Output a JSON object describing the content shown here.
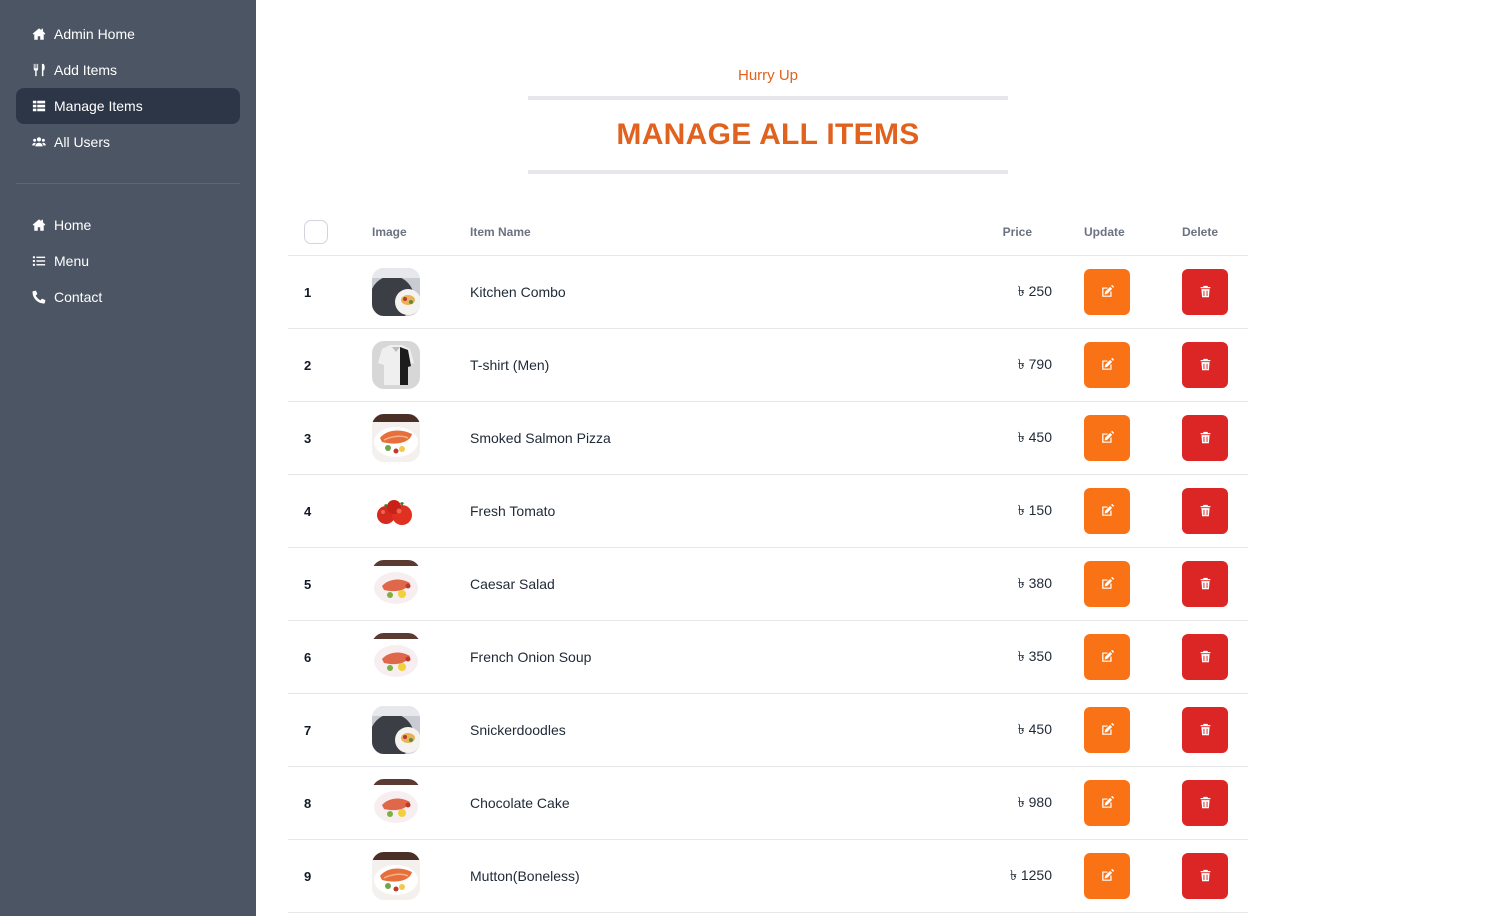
{
  "sidebar": {
    "admin_items": [
      {
        "label": "Admin Home",
        "icon": "home-icon"
      },
      {
        "label": "Add Items",
        "icon": "utensils-icon"
      },
      {
        "label": "Manage Items",
        "icon": "list-grid-icon",
        "active": true
      },
      {
        "label": "All Users",
        "icon": "users-icon"
      }
    ],
    "public_items": [
      {
        "label": "Home",
        "icon": "home-icon"
      },
      {
        "label": "Menu",
        "icon": "list-icon"
      },
      {
        "label": "Contact",
        "icon": "phone-icon"
      }
    ]
  },
  "section": {
    "subtitle": "Hurry Up",
    "title": "MANAGE ALL ITEMS"
  },
  "table": {
    "headers": {
      "image": "Image",
      "name": "Item Name",
      "price": "Price",
      "update": "Update",
      "delete": "Delete"
    },
    "currency": "৳",
    "rows": [
      {
        "num": "1",
        "name": "Kitchen Combo",
        "price": "৳ 250",
        "thumb": "plate-dark"
      },
      {
        "num": "2",
        "name": "T-shirt (Men)",
        "price": "৳ 790",
        "thumb": "shirt"
      },
      {
        "num": "3",
        "name": "Smoked Salmon Pizza",
        "price": "৳ 450",
        "thumb": "salmon"
      },
      {
        "num": "4",
        "name": "Fresh Tomato",
        "price": "৳ 150",
        "thumb": "tomato"
      },
      {
        "num": "5",
        "name": "Caesar Salad",
        "price": "৳ 380",
        "thumb": "salad-light"
      },
      {
        "num": "6",
        "name": "French Onion Soup",
        "price": "৳ 350",
        "thumb": "salad-light"
      },
      {
        "num": "7",
        "name": "Snickerdoodles",
        "price": "৳ 450",
        "thumb": "plate-dark"
      },
      {
        "num": "8",
        "name": "Chocolate Cake",
        "price": "৳ 980",
        "thumb": "salad-light"
      },
      {
        "num": "9",
        "name": "Mutton(Boneless)",
        "price": "৳ 1250",
        "thumb": "salmon"
      }
    ]
  },
  "colors": {
    "sidebar_bg": "#4b5563",
    "active_bg": "#2d3646",
    "accent": "#e1621f",
    "update_btn": "#f97316",
    "delete_btn": "#dc2626"
  }
}
